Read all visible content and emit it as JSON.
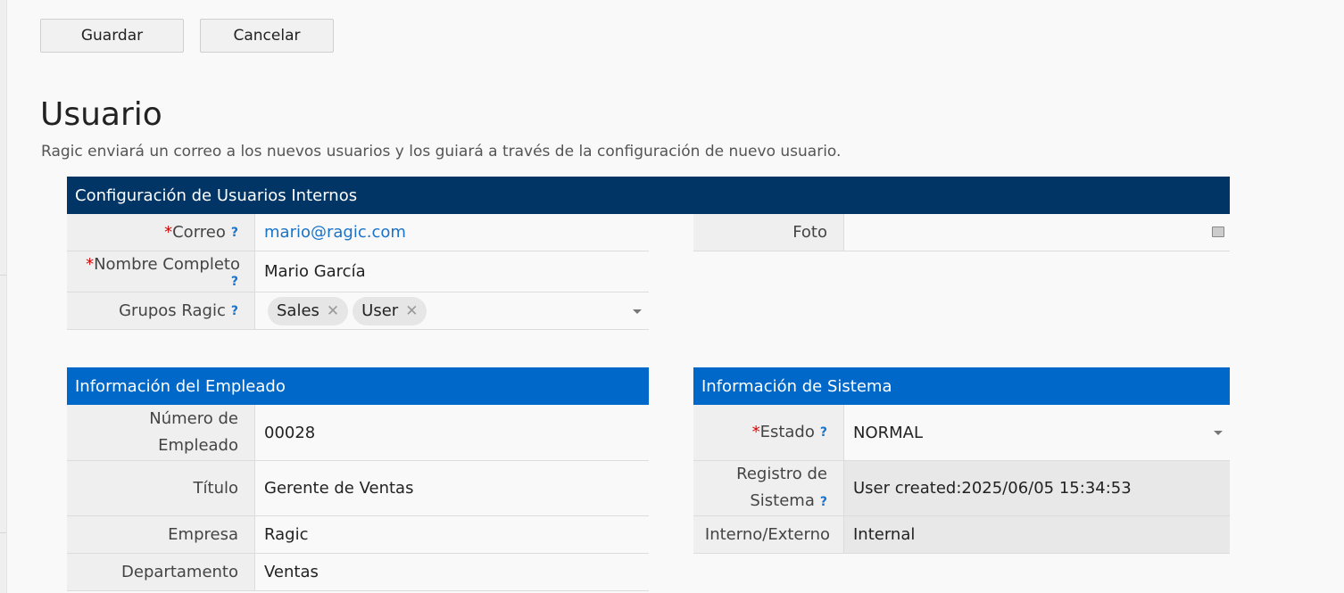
{
  "toolbar": {
    "save_label": "Guardar",
    "cancel_label": "Cancelar"
  },
  "page": {
    "title": "Usuario",
    "description": "Ragic enviará un correo a los nuevos usuarios y los guiará a través de la configuración de nuevo usuario."
  },
  "internal_config": {
    "header": "Configuración de Usuarios Internos",
    "email_label": "Correo",
    "email_value": "mario@ragic.com",
    "fullname_label": "Nombre Completo",
    "fullname_value": "Mario García",
    "groups_label": "Grupos Ragic",
    "groups": [
      "Sales",
      "User"
    ],
    "photo_label": "Foto",
    "photo_icon": "image-icon"
  },
  "employee_info": {
    "header": "Información del Empleado",
    "number_label_line1": "Número de",
    "number_label_line2": "Empleado",
    "number_value": "00028",
    "title_label": "Título",
    "title_value": "Gerente de Ventas",
    "company_label": "Empresa",
    "company_value": "Ragic",
    "department_label": "Departamento",
    "department_value": "Ventas"
  },
  "system_info": {
    "header": "Información de Sistema",
    "status_label": "Estado",
    "status_value": "NORMAL",
    "log_label_line1": "Registro de",
    "log_label_line2": "Sistema",
    "log_value": "User created:2025/06/05 15:34:53",
    "type_label": "Interno/Externo",
    "type_value": "Internal"
  },
  "symbols": {
    "required": "*",
    "help": "?",
    "remove": "✕"
  },
  "colors": {
    "header_dark": "#003566",
    "header_blue": "#0068c9",
    "link": "#1a73c8",
    "required": "#dd0000"
  }
}
